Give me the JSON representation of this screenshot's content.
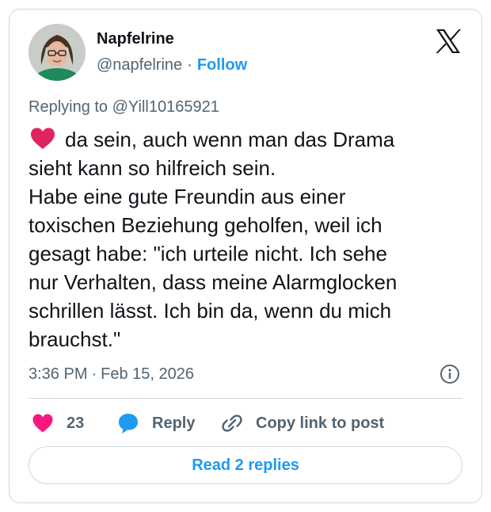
{
  "author": {
    "name": "Napfelrine",
    "handle": "@napfelrine",
    "separator": "·",
    "follow_label": "Follow"
  },
  "reply_context": "Replying to @Yill10165921",
  "tweet": {
    "leading_emoji": "red-heart",
    "lines": [
      "da sein, auch wenn man das Drama",
      "sieht kann so hilfreich sein.",
      "Habe eine gute Freundin aus einer",
      "toxischen Beziehung geholfen, weil ich",
      "gesagt habe: \"ich urteile nicht. Ich sehe",
      "nur Verhalten, dass meine Alarmglocken",
      "schrillen lässt. Ich bin da, wenn du mich",
      "brauchst.\""
    ]
  },
  "meta": {
    "time": "3:36 PM",
    "separator": "·",
    "date": "Feb 15, 2026"
  },
  "actions": {
    "like_count": "23",
    "reply_label": "Reply",
    "copy_label": "Copy link to post"
  },
  "read_replies_label": "Read 2 replies",
  "icons": {
    "brand": "x-logo-icon",
    "like": "heart-icon",
    "reply": "speech-bubble-icon",
    "copy": "link-icon",
    "info": "info-icon"
  },
  "colors": {
    "accent": "#1d9bf0",
    "like": "#f91880",
    "text": "#0f1419",
    "secondary": "#536471",
    "border": "#cfd9de",
    "emoji_heart": "#e0245e"
  }
}
